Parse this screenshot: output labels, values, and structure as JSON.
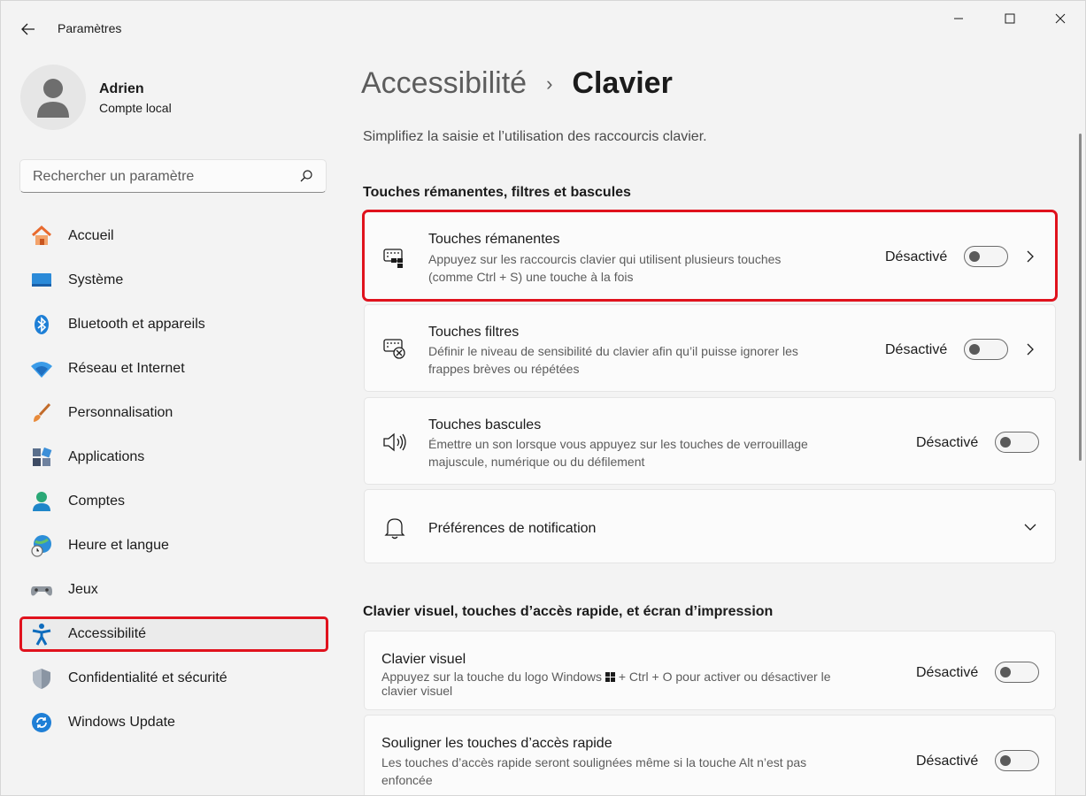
{
  "window": {
    "title": "Paramètres"
  },
  "profile": {
    "name": "Adrien",
    "account_type": "Compte local"
  },
  "search": {
    "placeholder": "Rechercher un paramètre"
  },
  "sidebar": {
    "items": [
      {
        "label": "Accueil",
        "icon": "home-icon"
      },
      {
        "label": "Système",
        "icon": "system-icon"
      },
      {
        "label": "Bluetooth et appareils",
        "icon": "bluetooth-icon"
      },
      {
        "label": "Réseau et Internet",
        "icon": "wifi-icon"
      },
      {
        "label": "Personnalisation",
        "icon": "brush-icon"
      },
      {
        "label": "Applications",
        "icon": "apps-icon"
      },
      {
        "label": "Comptes",
        "icon": "account-icon"
      },
      {
        "label": "Heure et langue",
        "icon": "globe-clock-icon"
      },
      {
        "label": "Jeux",
        "icon": "gamepad-icon"
      },
      {
        "label": "Accessibilité",
        "icon": "accessibility-icon",
        "active": true
      },
      {
        "label": "Confidentialité et sécurité",
        "icon": "shield-icon"
      },
      {
        "label": "Windows Update",
        "icon": "update-icon"
      }
    ]
  },
  "breadcrumb": {
    "parent": "Accessibilité",
    "separator": "›",
    "current": "Clavier"
  },
  "page": {
    "subtitle": "Simplifiez la saisie et l’utilisation des raccourcis clavier."
  },
  "sections": [
    {
      "heading": "Touches rémanentes, filtres et bascules",
      "cards": [
        {
          "title": "Touches rémanentes",
          "desc_line1": "Appuyez sur les raccourcis clavier qui utilisent plusieurs touches",
          "desc_line2": "(comme Ctrl + S) une touche à la fois",
          "state": "Désactivé",
          "icon": "sticky-keys-icon",
          "highlighted": true
        },
        {
          "title": "Touches filtres",
          "desc_line1": "Définir le niveau de sensibilité du clavier afin qu’il puisse ignorer les",
          "desc_line2": "frappes brèves ou répétées",
          "state": "Désactivé",
          "icon": "filter-keys-icon"
        },
        {
          "title": "Touches bascules",
          "desc_line1": "Émettre un son lorsque vous appuyez sur les touches de verrouillage",
          "desc_line2": "majuscule, numérique ou du défilement",
          "state": "Désactivé",
          "icon": "speaker-icon"
        },
        {
          "title": "Préférences de notification",
          "icon": "bell-icon"
        }
      ]
    },
    {
      "heading": "Clavier visuel, touches d’accès rapide, et écran d’impression",
      "cards": [
        {
          "title": "Clavier visuel",
          "desc_part1": "Appuyez sur la touche du logo Windows",
          "desc_part2": "+ Ctrl + O pour activer ou désactiver le",
          "desc_line2": "clavier visuel",
          "state": "Désactivé"
        },
        {
          "title": "Souligner les touches d’accès rapide",
          "desc_line1": "Les touches d’accès rapide seront soulignées même si la touche Alt n’est pas",
          "desc_line2": "enfoncée",
          "state": "Désactivé"
        }
      ]
    }
  ],
  "colors": {
    "highlight": "#e0121d",
    "accent": "#0067c0"
  }
}
